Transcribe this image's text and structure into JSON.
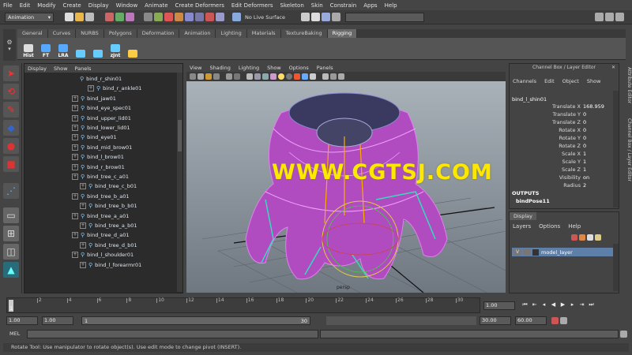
{
  "menubar": [
    "File",
    "Edit",
    "Modify",
    "Create",
    "Display",
    "Window",
    "Animate",
    "Create Deformers",
    "Edit Deformers",
    "Skeleton",
    "Skin",
    "Constrain",
    "Apps",
    "Help"
  ],
  "status": {
    "mode": "Animation",
    "live_surface": "No Live Surface"
  },
  "shelf_tabs": [
    "General",
    "Curves",
    "NURBS",
    "Polygons",
    "Deformation",
    "Animation",
    "Lighting",
    "Materials",
    "TextureBaking",
    "Rigging"
  ],
  "shelf_active": "Rigging",
  "shelf_buttons": [
    {
      "label": "Hist",
      "color": "#ddd"
    },
    {
      "label": "FT",
      "color": "#5af"
    },
    {
      "label": "LRA",
      "color": "#5af"
    },
    {
      "label": "",
      "color": "#6cf"
    },
    {
      "label": "",
      "color": "#6cf"
    },
    {
      "label": "zJnt",
      "color": "#6cf"
    },
    {
      "label": "",
      "color": "#fc4"
    }
  ],
  "outliner": {
    "menu": [
      "Display",
      "Show",
      "Panels"
    ],
    "items": [
      {
        "label": "bind_r_shin01",
        "indent": 1,
        "plus": false
      },
      {
        "label": "bind_r_ankle01",
        "indent": 2,
        "plus": true
      },
      {
        "label": "bind_jaw01",
        "indent": 0,
        "plus": true
      },
      {
        "label": "bind_eye_spec01",
        "indent": 0,
        "plus": true
      },
      {
        "label": "bind_upper_lid01",
        "indent": 0,
        "plus": true
      },
      {
        "label": "bind_lower_lid01",
        "indent": 0,
        "plus": true
      },
      {
        "label": "bind_eye01",
        "indent": 0,
        "plus": true
      },
      {
        "label": "bind_mid_brow01",
        "indent": 0,
        "plus": true
      },
      {
        "label": "bind_l_brow01",
        "indent": 0,
        "plus": true
      },
      {
        "label": "bind_r_brow01",
        "indent": 0,
        "plus": true
      },
      {
        "label": "bind_tree_c_a01",
        "indent": 0,
        "plus": true
      },
      {
        "label": "bind_tree_c_b01",
        "indent": 1,
        "plus": true
      },
      {
        "label": "bind_tree_b_a01",
        "indent": 0,
        "plus": true
      },
      {
        "label": "bind_tree_b_b01",
        "indent": 1,
        "plus": true
      },
      {
        "label": "bind_tree_a_a01",
        "indent": 0,
        "plus": true
      },
      {
        "label": "bind_tree_a_b01",
        "indent": 1,
        "plus": true
      },
      {
        "label": "bind_tree_d_a01",
        "indent": 0,
        "plus": true
      },
      {
        "label": "bind_tree_d_b01",
        "indent": 1,
        "plus": true
      },
      {
        "label": "bind_l_shoulder01",
        "indent": 0,
        "plus": true
      },
      {
        "label": "bind_l_forearmr01",
        "indent": 1,
        "plus": true
      }
    ]
  },
  "viewport": {
    "menu": [
      "View",
      "Shading",
      "Lighting",
      "Show",
      "Options",
      "Panels"
    ],
    "watermark": "WWW.CGTSJ.COM",
    "camera_label": "persp"
  },
  "channel_box": {
    "title": "Channel Box / Layer Editor",
    "menu": [
      "Channels",
      "Edit",
      "Object",
      "Show"
    ],
    "object": "bind_l_shin01",
    "attributes": [
      {
        "name": "Translate X",
        "value": "168.959"
      },
      {
        "name": "Translate Y",
        "value": "0"
      },
      {
        "name": "Translate Z",
        "value": "0"
      },
      {
        "name": "Rotate X",
        "value": "0"
      },
      {
        "name": "Rotate Y",
        "value": "0"
      },
      {
        "name": "Rotate Z",
        "value": "0"
      },
      {
        "name": "Scale X",
        "value": "1"
      },
      {
        "name": "Scale Y",
        "value": "1"
      },
      {
        "name": "Scale Z",
        "value": "1"
      },
      {
        "name": "Visibility",
        "value": "on"
      },
      {
        "name": "Radius",
        "value": "2"
      }
    ],
    "outputs_label": "OUTPUTS",
    "output_node": "bindPose11"
  },
  "layer_editor": {
    "tab": "Display",
    "menu": [
      "Layers",
      "Options",
      "Help"
    ],
    "layer": {
      "visible": "V",
      "name": "model_layer"
    }
  },
  "side_labels": [
    "Attribute Editor",
    "Channel Box / Layer Editor"
  ],
  "timeline": {
    "ticks": [
      "2",
      "4",
      "6",
      "8",
      "10",
      "12",
      "14",
      "16",
      "18",
      "20",
      "22",
      "24",
      "26",
      "28",
      "30"
    ],
    "current": "1",
    "current_field": "1.00"
  },
  "range": {
    "start": "1.00",
    "start2": "1.00",
    "slider_start": "1",
    "slider_end": "30",
    "end": "30.00",
    "end2": "60.00"
  },
  "command": {
    "label": "MEL"
  },
  "help": "Rotate Tool: Use manipulator to rotate object(s). Use edit mode to change pivot (INSERT)."
}
